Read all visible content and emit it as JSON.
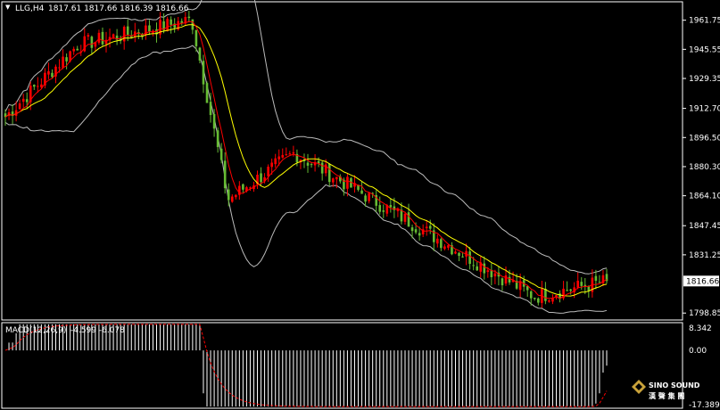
{
  "header": {
    "symbol": "LLG,H4",
    "ohlc": "1817.61 1817.66 1816.39 1816.66"
  },
  "macd_header": {
    "label": "MACD(12,26,9)",
    "values": "-4.599 -6.078"
  },
  "logo": {
    "line1": "SINO SOUND",
    "line2": "漢 聲 集 團"
  },
  "colors": {
    "background": "#000000",
    "grid": "#ffffff",
    "bull": "#ff0000",
    "bear": "#66bb33",
    "ma_fast": "#ff0000",
    "ma_slow": "#ffff00",
    "bands": "#bbbbbb",
    "macd_hist": "#ffffff",
    "macd_signal": "#ff0000",
    "price_tag_bg": "#ffffff",
    "price_tag_text": "#000000"
  },
  "chart_data": [
    {
      "type": "candlestick",
      "title": "LLG,H4",
      "ylim": [
        1795,
        1972
      ],
      "y_ticks": [
        "1961.75",
        "1945.55",
        "1929.35",
        "1912.70",
        "1896.50",
        "1880.30",
        "1864.10",
        "1847.45",
        "1831.25",
        "1816.66",
        "1798.85"
      ],
      "current_price": "1816.66",
      "indicators": [
        "moving-average-fast",
        "moving-average-slow",
        "bollinger-bands"
      ],
      "key_points": [
        {
          "label": "start",
          "value": 1908
        },
        {
          "label": "early-high",
          "value": 1948
        },
        {
          "label": "peak",
          "value": 1962
        },
        {
          "label": "crash-low",
          "value": 1862
        },
        {
          "label": "rebound-high",
          "value": 1888
        },
        {
          "label": "low",
          "value": 1808
        },
        {
          "label": "close",
          "value": 1816.66
        }
      ]
    },
    {
      "type": "bar",
      "title": "MACD(12,26,9)",
      "ylim": [
        -17.389,
        8.342
      ],
      "y_ticks": [
        "8.342",
        "0.00",
        "-17.389"
      ],
      "macd_value": -4.599,
      "signal_value": -6.078
    }
  ]
}
